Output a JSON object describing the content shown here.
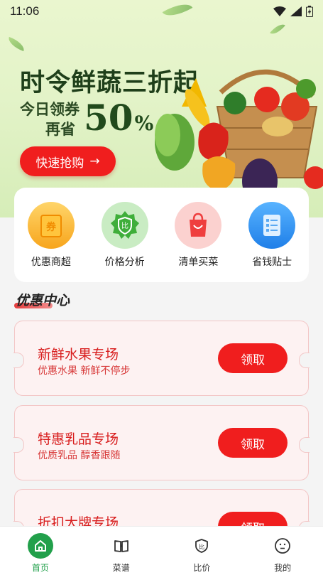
{
  "status_bar": {
    "time": "11:06"
  },
  "banner": {
    "headline": "时令鲜蔬三折起",
    "line1": "今日领券",
    "line2": "再省",
    "discount_value": "50",
    "discount_unit": "%",
    "cta_label": "快速抢购",
    "cta_arrow": "→"
  },
  "quick_menu": [
    {
      "label": "优惠商超",
      "icon": "ticket-icon",
      "color": "#f7a51c"
    },
    {
      "label": "价格分析",
      "icon": "shield-badge-icon",
      "color": "#3fae3a"
    },
    {
      "label": "清单买菜",
      "icon": "shopping-bag-icon",
      "color": "#ef3e3e"
    },
    {
      "label": "省钱贴士",
      "icon": "checklist-icon",
      "color": "#2d8ef0"
    }
  ],
  "section": {
    "title": "优惠中心"
  },
  "coupons": [
    {
      "title": "新鲜水果专场",
      "subtitle": "优惠水果  新鲜不停步",
      "button": "领取"
    },
    {
      "title": "特惠乳品专场",
      "subtitle": "优质乳品  醇香跟随",
      "button": "领取"
    },
    {
      "title": "折扣大牌专场",
      "subtitle": "",
      "button": "领取"
    }
  ],
  "bottom_nav": [
    {
      "label": "首页",
      "icon": "home-icon",
      "active": true
    },
    {
      "label": "菜谱",
      "icon": "recipe-book-icon",
      "active": false
    },
    {
      "label": "比价",
      "icon": "price-compare-icon",
      "active": false
    },
    {
      "label": "我的",
      "icon": "profile-face-icon",
      "active": false
    }
  ],
  "colors": {
    "accent_red": "#f01e1e",
    "accent_green": "#22a04b",
    "background": "#f4f4f4"
  }
}
